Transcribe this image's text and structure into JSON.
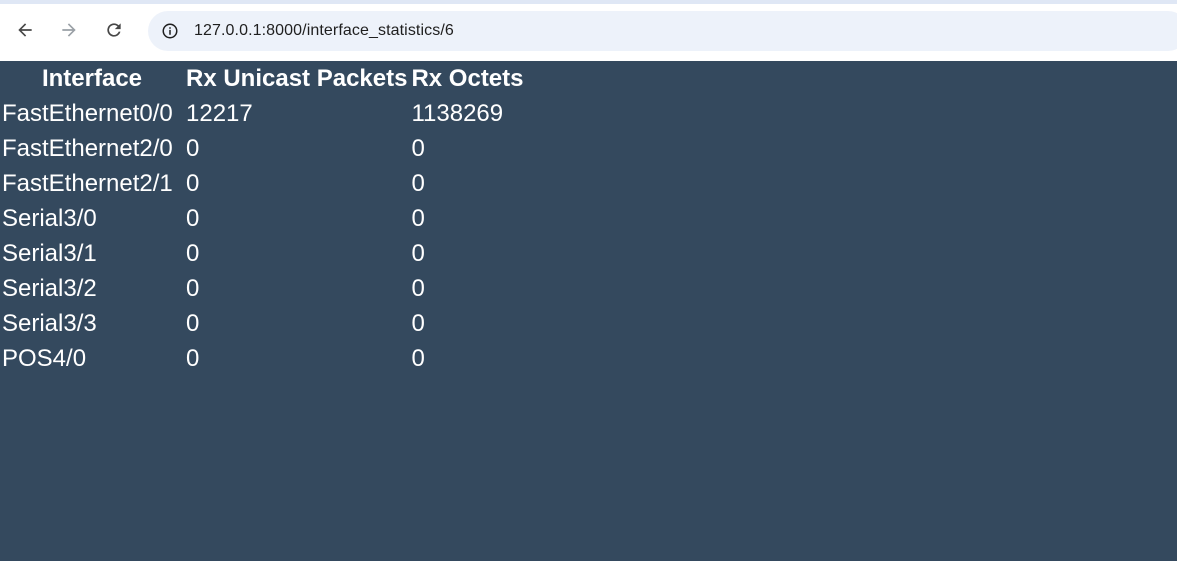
{
  "browser": {
    "url": "127.0.0.1:8000/interface_statistics/6"
  },
  "table": {
    "headers": [
      "Interface",
      "Rx Unicast Packets",
      "Rx Octets"
    ],
    "rows": [
      [
        "FastEthernet0/0",
        "12217",
        "1138269"
      ],
      [
        "FastEthernet2/0",
        "0",
        "0"
      ],
      [
        "FastEthernet2/1",
        "0",
        "0"
      ],
      [
        "Serial3/0",
        "0",
        "0"
      ],
      [
        "Serial3/1",
        "0",
        "0"
      ],
      [
        "Serial3/2",
        "0",
        "0"
      ],
      [
        "Serial3/3",
        "0",
        "0"
      ],
      [
        "POS4/0",
        "0",
        "0"
      ]
    ]
  },
  "colors": {
    "page_background": "#34495e",
    "text": "#ffffff"
  }
}
